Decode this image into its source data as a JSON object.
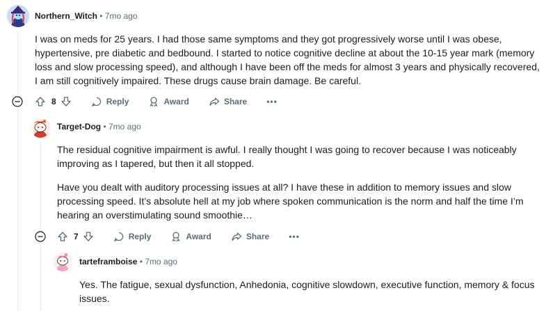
{
  "comments": [
    {
      "author": "Northern_Witch",
      "time": "7mo ago",
      "paragraphs": [
        "I was on meds for 25 years. I had those same symptoms and they got progressively worse until I was obese, hypertensive, pre diabetic and bedbound. I started to notice cognitive decline at about the 10-15 year mark (memory loss and slow processing speed), and although I have been off the meds for almost 3 years and physically recovered, I am still cognitively impaired. These drugs cause brain damage. Be careful."
      ],
      "votes": "8"
    },
    {
      "author": "Target-Dog",
      "time": "7mo ago",
      "paragraphs": [
        "The residual cognitive impairment is awful. I really thought I was going to recover because I was noticeably improving as I tapered, but then it all stopped.",
        "Have you dealt with auditory processing issues at all? I have these in addition to memory issues and slow processing speed. It’s absolute hell at my job where spoken communication is the norm and half the time I’m hearing an overstimulating sound smoothie…"
      ],
      "votes": "7"
    },
    {
      "author": "tarteframboise",
      "time": "7mo ago",
      "paragraphs": [
        "Yes. The fatigue, sexual dysfunction, Anhedonia, cognitive slowdown, executive function, memory & focus issues."
      ]
    }
  ],
  "actions": {
    "reply": "Reply",
    "award": "Award",
    "share": "Share",
    "more": "•••"
  },
  "separator": "•",
  "colors": {
    "meta": "#576f76",
    "text": "#1c1c1c",
    "thread_line": "#e5ebee"
  }
}
